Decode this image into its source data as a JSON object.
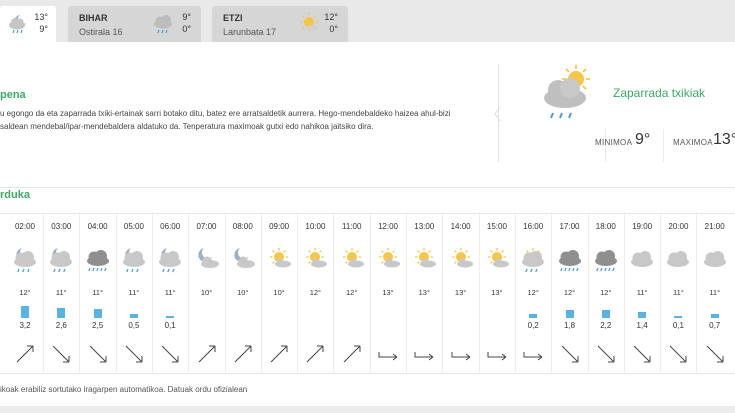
{
  "tabs": [
    {
      "name": "",
      "date": "",
      "max": "13°",
      "min": "9°",
      "icon": "cloud-moon-rain-icon",
      "active": true
    },
    {
      "name": "BIHAR",
      "date": "Ostirala 16",
      "max": "9°",
      "min": "0°",
      "icon": "cloud-rain-icon",
      "active": false
    },
    {
      "name": "ETZI",
      "date": "Larunbata 17",
      "max": "12°",
      "min": "0°",
      "icon": "sun-cloud-icon",
      "active": false
    }
  ],
  "forecast": {
    "title": "pena",
    "text_line1": "u egongo da eta zaparrada txiki-ertainak sarri botako ditu, batez ere arratsaldetik aurrera. Hego-mendebaldeko haizea ahul-bizi",
    "text_line2": "saldean mendebal/ipar-mendebaldera aldatuko da. Tenperatura maximoak gutxi edo nahikoa jaitsiko dira."
  },
  "summary": {
    "label": "Zaparrada txikiak",
    "icon": "sun-cloud-rain-icon",
    "min_label": "MINIMOA",
    "min_value": "9°",
    "max_label": "MAXIMOA",
    "max_value": "13°"
  },
  "hourly_title": "rduka",
  "hours": [
    {
      "time": "02:00",
      "icon": "moon-cloud-rain",
      "temp": "12°",
      "prec": "3,2",
      "level": 0.9,
      "dir": "ne"
    },
    {
      "time": "03:00",
      "icon": "moon-cloud-rain",
      "temp": "11°",
      "prec": "2,6",
      "level": 0.75,
      "dir": "se"
    },
    {
      "time": "04:00",
      "icon": "cloud-heavy-rain",
      "temp": "11°",
      "prec": "2,5",
      "level": 0.7,
      "dir": "se"
    },
    {
      "time": "05:00",
      "icon": "moon-cloud-rain",
      "temp": "11°",
      "prec": "0,5",
      "level": 0.3,
      "dir": "se"
    },
    {
      "time": "06:00",
      "icon": "moon-cloud-rain",
      "temp": "11°",
      "prec": "0,1",
      "level": 0,
      "dir": "se"
    },
    {
      "time": "07:00",
      "icon": "moon-cloud",
      "temp": "10°",
      "prec": "",
      "level": 0,
      "dir": "ne"
    },
    {
      "time": "08:00",
      "icon": "moon-cloud",
      "temp": "10°",
      "prec": "",
      "level": 0,
      "dir": "ne"
    },
    {
      "time": "09:00",
      "icon": "sun-cloud",
      "temp": "10°",
      "prec": "",
      "level": 0,
      "dir": "ne"
    },
    {
      "time": "10:00",
      "icon": "sun-cloud",
      "temp": "12°",
      "prec": "",
      "level": 0,
      "dir": "ne"
    },
    {
      "time": "11:00",
      "icon": "sun-cloud",
      "temp": "12°",
      "prec": "",
      "level": 0,
      "dir": "ne"
    },
    {
      "time": "12:00",
      "icon": "sun-cloud",
      "temp": "13°",
      "prec": "",
      "level": 0,
      "dir": "e"
    },
    {
      "time": "13:00",
      "icon": "sun-cloud",
      "temp": "13°",
      "prec": "",
      "level": 0,
      "dir": "e"
    },
    {
      "time": "14:00",
      "icon": "sun-cloud",
      "temp": "13°",
      "prec": "",
      "level": 0,
      "dir": "e"
    },
    {
      "time": "15:00",
      "icon": "sun-cloud",
      "temp": "13°",
      "prec": "",
      "level": 0,
      "dir": "e"
    },
    {
      "time": "16:00",
      "icon": "sun-cloud-rain",
      "temp": "12°",
      "prec": "0,2",
      "level": 0.15,
      "dir": "e"
    },
    {
      "time": "17:00",
      "icon": "dark-cloud-rain",
      "temp": "12°",
      "prec": "1,8",
      "level": 0.6,
      "dir": "se"
    },
    {
      "time": "18:00",
      "icon": "dark-cloud-rain",
      "temp": "12°",
      "prec": "2,2",
      "level": 0.65,
      "dir": "se"
    },
    {
      "time": "19:00",
      "icon": "cloud",
      "temp": "11°",
      "prec": "1,4",
      "level": 0.45,
      "dir": "se"
    },
    {
      "time": "20:00",
      "icon": "cloud",
      "temp": "11°",
      "prec": "0,1",
      "level": 0,
      "dir": "se"
    },
    {
      "time": "21:00",
      "icon": "cloud",
      "temp": "11°",
      "prec": "0,7",
      "level": 0.25,
      "dir": "se"
    }
  ],
  "footer": "ikoak erabiliz sortutako iragarpen automatikoa. Datuak ordu ofizialean"
}
